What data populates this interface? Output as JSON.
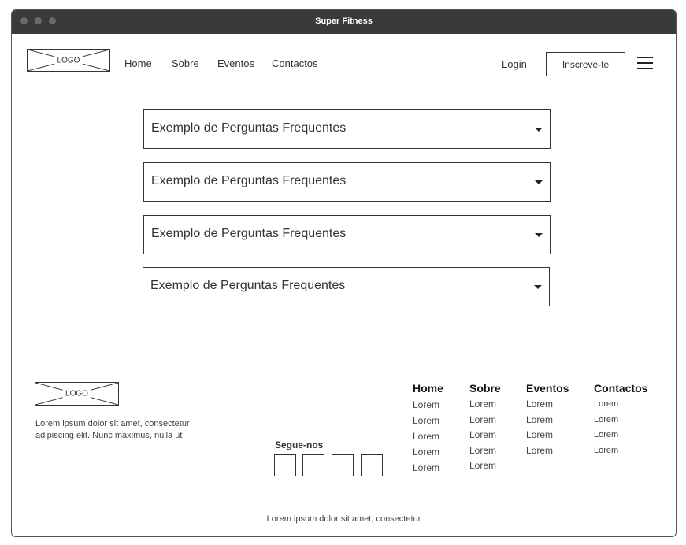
{
  "window": {
    "title": "Super Fitness"
  },
  "header": {
    "logo_text": "LOGO",
    "nav": [
      "Home",
      "Sobre",
      "Eventos",
      "Contactos"
    ],
    "login_label": "Login",
    "signup_label": "Inscreve-te",
    "menu_icon": "hamburger-menu-icon"
  },
  "faq": {
    "items": [
      "Exemplo de Perguntas Frequentes",
      "Exemplo de Perguntas Frequentes",
      "Exemplo de Perguntas Frequentes",
      "Exemplo de Perguntas Frequentes"
    ],
    "caret_icon": "caret-down-icon"
  },
  "footer": {
    "logo_text": "LOGO",
    "description": "Lorem ipsum dolor sit amet, consectetur adipiscing elit. Nunc maximus, nulla ut",
    "follow_title": "Segue-nos",
    "columns": [
      {
        "title": "Home",
        "items": [
          "Lorem",
          "Lorem",
          "Lorem",
          "Lorem",
          "Lorem"
        ]
      },
      {
        "title": "Sobre",
        "items": [
          "Lorem",
          "Lorem",
          "Lorem",
          "Lorem",
          "Lorem"
        ]
      },
      {
        "title": "Eventos",
        "items": [
          "Lorem",
          "Lorem",
          "Lorem",
          "Lorem"
        ]
      },
      {
        "title": "Contactos",
        "items": [
          "Lorem",
          "Lorem",
          "Lorem",
          "Lorem"
        ]
      }
    ],
    "copyright": "Lorem ipsum dolor sit amet, consectetur"
  }
}
